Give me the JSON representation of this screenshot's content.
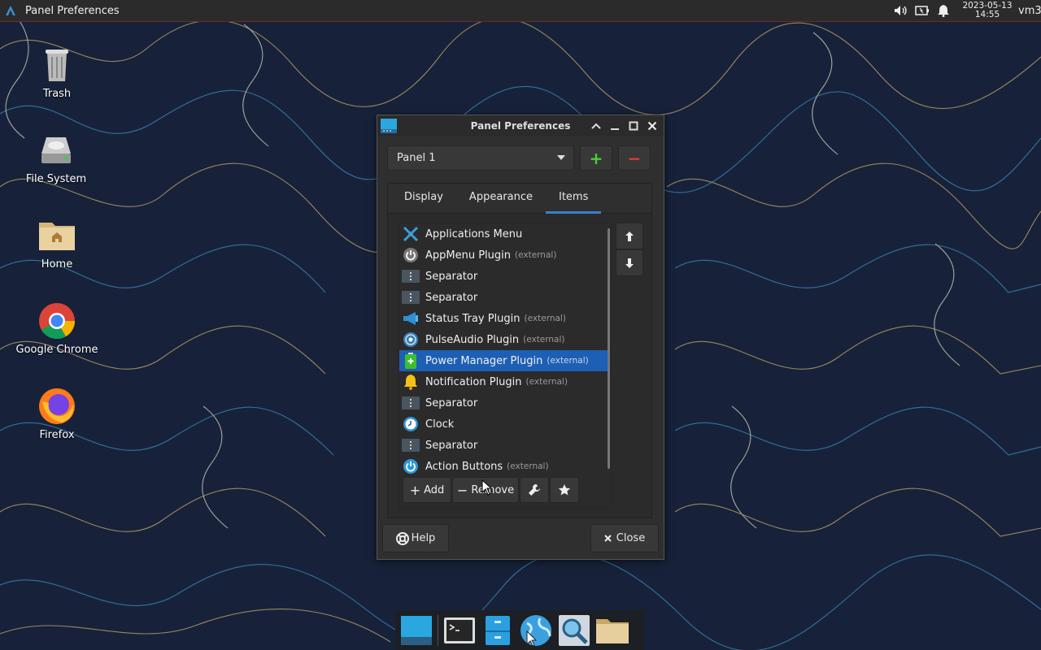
{
  "top_panel": {
    "window_title": "Panel Preferences",
    "clock_date": "2023-05-13",
    "clock_time": "14:55",
    "user": "vm3",
    "tray_icons": [
      "volume-icon",
      "battery-icon",
      "bell-icon"
    ],
    "border_color": "#6e2a2a"
  },
  "desktop": {
    "icons": [
      {
        "label": "Trash",
        "icon": "trash-icon"
      },
      {
        "label": "File System",
        "icon": "drive-icon"
      },
      {
        "label": "Home",
        "icon": "home-folder-icon"
      },
      {
        "label": "Google Chrome",
        "icon": "chrome-icon"
      },
      {
        "label": "Firefox",
        "icon": "firefox-icon"
      }
    ]
  },
  "window": {
    "title": "Panel Preferences",
    "panel_select": "Panel 1",
    "add_panel": "+",
    "remove_panel": "−",
    "tabs": [
      {
        "label": "Display",
        "active": false
      },
      {
        "label": "Appearance",
        "active": false
      },
      {
        "label": "Items",
        "active": true
      }
    ],
    "items": [
      {
        "name": "Applications Menu",
        "ext": "",
        "icon": "xfce-menu-icon"
      },
      {
        "name": "AppMenu Plugin",
        "ext": "(external)",
        "icon": "power-gray-icon"
      },
      {
        "name": "Separator",
        "ext": "",
        "icon": "separator-icon"
      },
      {
        "name": "Separator",
        "ext": "",
        "icon": "separator-icon"
      },
      {
        "name": "Status Tray Plugin",
        "ext": "(external)",
        "icon": "megaphone-icon"
      },
      {
        "name": "PulseAudio Plugin",
        "ext": "(external)",
        "icon": "audio-icon"
      },
      {
        "name": "Power Manager Plugin",
        "ext": "(external)",
        "icon": "battery-green-icon",
        "selected": true
      },
      {
        "name": "Notification Plugin",
        "ext": "(external)",
        "icon": "bell-yellow-icon"
      },
      {
        "name": "Separator",
        "ext": "",
        "icon": "separator-icon"
      },
      {
        "name": "Clock",
        "ext": "",
        "icon": "clock-icon"
      },
      {
        "name": "Separator",
        "ext": "",
        "icon": "separator-icon"
      },
      {
        "name": "Action Buttons",
        "ext": "(external)",
        "icon": "power-blue-icon"
      }
    ],
    "add_label": "Add",
    "remove_label": "Remove",
    "help_label": "Help",
    "close_label": "Close",
    "accent": "#1d5fb4",
    "tab_accent": "#3a80c8"
  },
  "dock": {
    "items": [
      "show-desktop-icon",
      "terminal-icon",
      "file-manager-icon",
      "web-browser-icon",
      "app-finder-icon",
      "folder-icon"
    ]
  }
}
